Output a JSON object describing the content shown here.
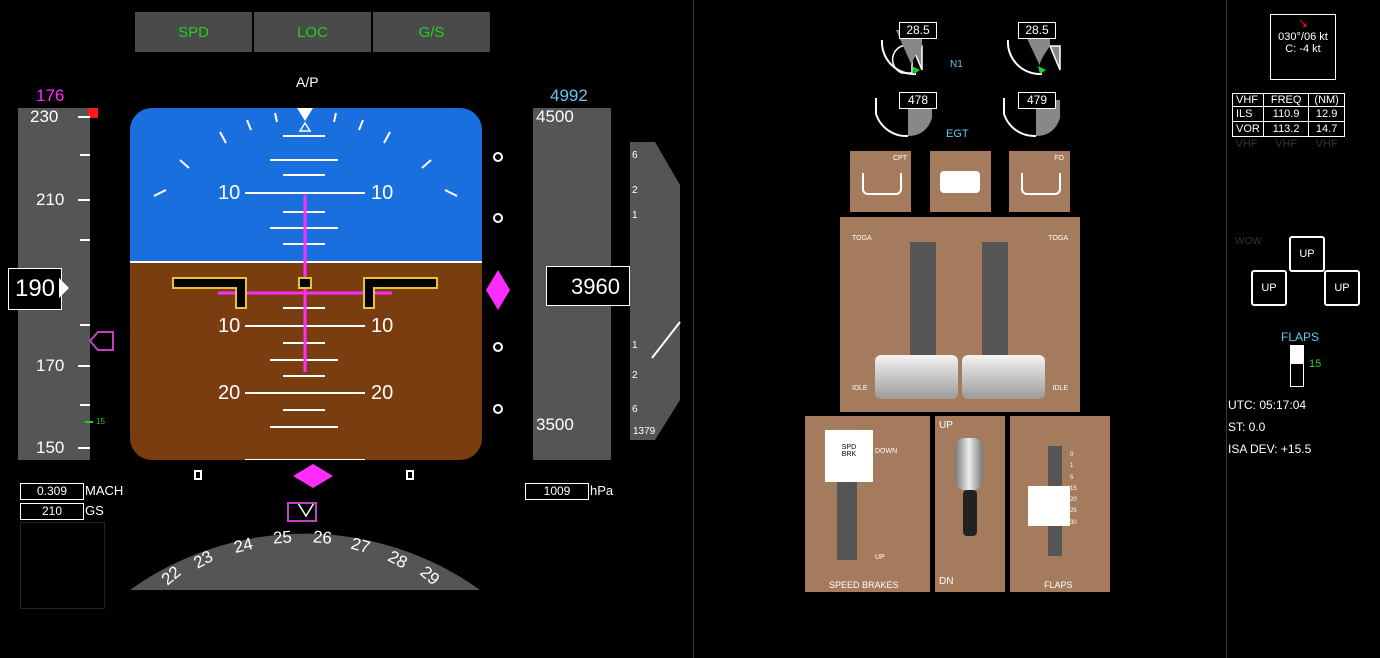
{
  "fma": {
    "speed_mode": "SPD",
    "lateral_mode": "LOC",
    "vertical_mode": "G/S"
  },
  "autopilot": {
    "label": "A/P"
  },
  "speed": {
    "target": "176",
    "current": "190",
    "tape_ticks": [
      "230",
      "210",
      "170",
      "150"
    ],
    "mach_value": "0.309",
    "mach_label": "MACH",
    "gs_value": "210",
    "gs_label": "GS",
    "flap_marker": "15"
  },
  "attitude": {
    "pitch_labels": [
      "10",
      "10",
      "10",
      "10",
      "20",
      "20",
      "20",
      "20"
    ]
  },
  "altitude": {
    "target": "4992",
    "current_main": "39",
    "current_roll": "60",
    "tape_ticks": [
      "4500",
      "3500"
    ],
    "baro_value": "1009",
    "baro_label": "hPa"
  },
  "vsi": {
    "labels_up": [
      "6",
      "2",
      "1"
    ],
    "labels_down": [
      "1",
      "2",
      "6"
    ],
    "value": "1379"
  },
  "heading": {
    "labels": [
      "22",
      "23",
      "24",
      "25",
      "26",
      "27",
      "28",
      "29"
    ]
  },
  "engines": {
    "n1_label": "N1",
    "n1_left": "28.5",
    "n1_right": "28.5",
    "egt_label": "EGT",
    "egt_left": "478",
    "egt_right": "479"
  },
  "throttle": {
    "cpt_label": "CPT",
    "fo_label": "FO",
    "toga_left": "TOGA",
    "toga_right": "TOGA",
    "idle_left": "IDLE",
    "idle_right": "IDLE"
  },
  "speedbrake": {
    "title": "SPEED BRAKES",
    "handle_label_1": "SPD",
    "handle_label_2": "BRK",
    "down_label": "DOWN",
    "up_label": "UP"
  },
  "gear": {
    "up_label": "UP",
    "dn_label": "DN"
  },
  "flaps_lever": {
    "title": "FLAPS",
    "detents": [
      "0",
      "1",
      "5",
      "15",
      "20",
      "25",
      "30"
    ]
  },
  "wind": {
    "line1": "030°/06 kt",
    "line2": "C: -4 kt"
  },
  "radio": {
    "headers": [
      "VHF",
      "FREQ",
      "(NM)"
    ],
    "rows": [
      [
        "ILS",
        "110.9",
        "12.9"
      ],
      [
        "VOR",
        "113.2",
        "14.7"
      ]
    ],
    "ghost": [
      "VHF",
      "VHF",
      "VHF"
    ]
  },
  "gear_status": {
    "wow_label": "WOW",
    "nose": "UP",
    "left": "UP",
    "right": "UP"
  },
  "flaps_indicator": {
    "label": "FLAPS",
    "value": "15"
  },
  "status": {
    "utc": "UTC: 05:17:04",
    "st": "ST: 0.0",
    "isa": "ISA DEV: +15.5"
  },
  "colors": {
    "sky": "#1a6fdf",
    "ground": "#7a3d0f",
    "magenta": "#ff2cff",
    "green": "#1fd11f",
    "cyan": "#62c7ea",
    "panel": "#a57b5e"
  }
}
